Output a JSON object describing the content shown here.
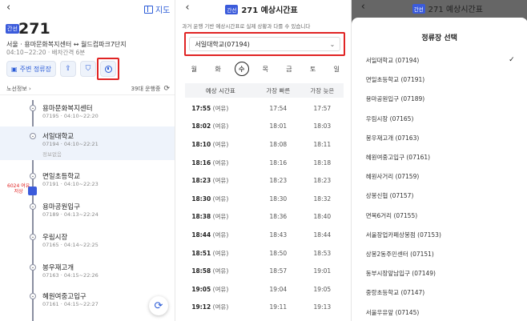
{
  "left_panel": {
    "map_label": "지도",
    "badge": "간선",
    "route_number": "271",
    "route_desc": "서울 · 용마문화복지센터 ↔ 월드컵파크7단지",
    "route_time": "04:10~22:20 · 배차간격 6분",
    "main_stop_label": "주변 정류장",
    "route_info_label": "노선정보",
    "running_count": "39대 운행중",
    "bus_marker": "6024 여유\n저상",
    "stops": [
      {
        "name": "용마문화복지센터",
        "sub": "07195 · 04:10~22:20",
        "extra": ""
      },
      {
        "name": "서일대학교",
        "sub": "07194 · 04:10~22:21",
        "extra": "정보없음"
      },
      {
        "name": "면일초등학교",
        "sub": "07191 · 04:10~22:23",
        "extra": ""
      },
      {
        "name": "용마공원입구",
        "sub": "07189 · 04:13~22:24",
        "extra": ""
      },
      {
        "name": "우림시장",
        "sub": "07165 · 04:14~22:25",
        "extra": ""
      },
      {
        "name": "봉우재고개",
        "sub": "07163 · 04:15~22:26",
        "extra": ""
      },
      {
        "name": "혜원여중고입구",
        "sub": "07161 · 04:15~22:27",
        "extra": ""
      }
    ]
  },
  "middle_panel": {
    "badge": "간선",
    "title": "271 예상시간표",
    "note": "과거 운행 기반 예상시간표로 실제 상황과 다를 수 있습니다",
    "selected_stop": "서일대학교(07194)",
    "days": [
      "월",
      "화",
      "수",
      "목",
      "금",
      "토",
      "일"
    ],
    "selected_day": "수",
    "headers": [
      "예상 시간표",
      "가장 빠른",
      "가장 늦은"
    ],
    "rows": [
      {
        "time": "17:55",
        "status": "(여유)",
        "fast": "17:54",
        "late": "17:57"
      },
      {
        "time": "18:02",
        "status": "(여유)",
        "fast": "18:01",
        "late": "18:03"
      },
      {
        "time": "18:10",
        "status": "(여유)",
        "fast": "18:08",
        "late": "18:11"
      },
      {
        "time": "18:16",
        "status": "(여유)",
        "fast": "18:16",
        "late": "18:18"
      },
      {
        "time": "18:23",
        "status": "(여유)",
        "fast": "18:23",
        "late": "18:23"
      },
      {
        "time": "18:30",
        "status": "(여유)",
        "fast": "18:30",
        "late": "18:32"
      },
      {
        "time": "18:38",
        "status": "(여유)",
        "fast": "18:36",
        "late": "18:40"
      },
      {
        "time": "18:44",
        "status": "(여유)",
        "fast": "18:43",
        "late": "18:44"
      },
      {
        "time": "18:51",
        "status": "(여유)",
        "fast": "18:50",
        "late": "18:53"
      },
      {
        "time": "18:58",
        "status": "(여유)",
        "fast": "18:57",
        "late": "19:01"
      },
      {
        "time": "19:05",
        "status": "(여유)",
        "fast": "19:04",
        "late": "19:05"
      },
      {
        "time": "19:12",
        "status": "(여유)",
        "fast": "19:11",
        "late": "19:13"
      }
    ]
  },
  "right_panel": {
    "badge": "간선",
    "title": "271 예상시간표",
    "sheet_title": "정류장 선택",
    "options": [
      "서일대학교 (07194)",
      "면일초등학교 (07191)",
      "용마공원입구 (07189)",
      "우림시장 (07165)",
      "봉우재고개 (07163)",
      "혜원여중고입구 (07161)",
      "혜원사거리 (07159)",
      "상봉신협 (07157)",
      "면목6거리 (07155)",
      "서울장업카페상봉점 (07153)",
      "상봉2동주민센터 (07151)",
      "동부시장앞남입구 (07149)",
      "중랑초등학교 (07147)",
      "서울우유앞 (07145)"
    ],
    "selected_index": 0
  },
  "colors": {
    "accent": "#2a5bd7",
    "badge": "#3b5bdb",
    "highlight": "#e02424"
  }
}
